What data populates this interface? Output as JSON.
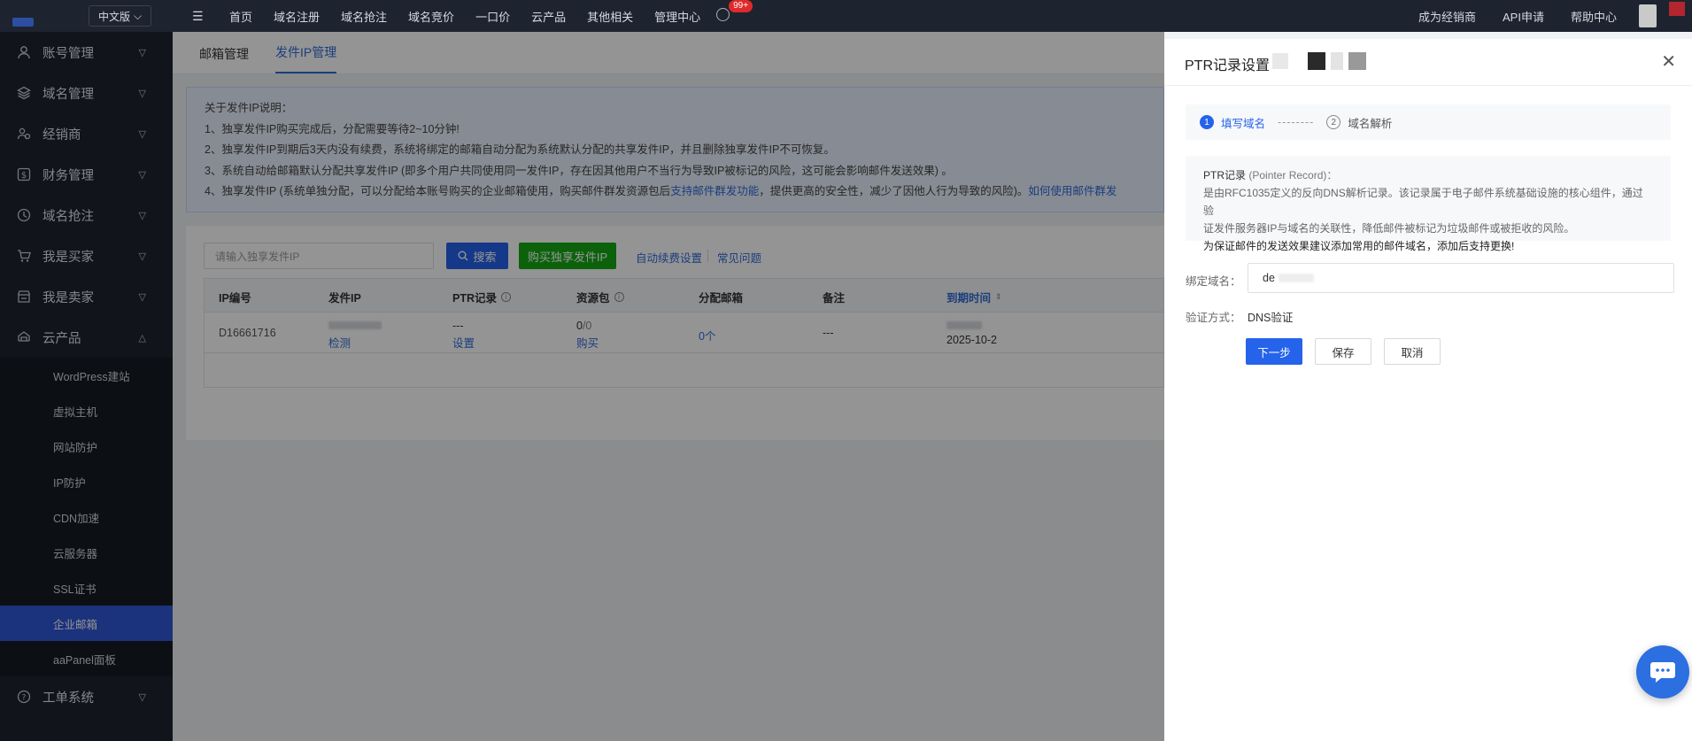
{
  "topbar": {
    "language": "中文版",
    "nav": [
      "首页",
      "域名注册",
      "域名抢注",
      "域名竞价",
      "一口价",
      "云产品",
      "其他相关",
      "管理中心"
    ],
    "badge": "99+",
    "right": [
      "成为经销商",
      "API申请",
      "帮助中心"
    ]
  },
  "sidebar": {
    "items": [
      {
        "label": "账号管理",
        "icon": "user-icon"
      },
      {
        "label": "域名管理",
        "icon": "layers-icon"
      },
      {
        "label": "经销商",
        "icon": "group-icon"
      },
      {
        "label": "财务管理",
        "icon": "dollar-icon"
      },
      {
        "label": "域名抢注",
        "icon": "clock-icon"
      },
      {
        "label": "我是买家",
        "icon": "cart-icon"
      },
      {
        "label": "我是卖家",
        "icon": "shop-icon"
      },
      {
        "label": "云产品",
        "icon": "cloud-icon"
      }
    ],
    "sub_items": [
      "WordPress建站",
      "虚拟主机",
      "网站防护",
      "IP防护",
      "CDN加速",
      "云服务器",
      "SSL证书",
      "企业邮箱",
      "aaPanel面板"
    ],
    "active_sub": "企业邮箱",
    "bottom_item": {
      "label": "工单系统",
      "icon": "help-icon"
    }
  },
  "main": {
    "tabs": [
      "邮箱管理",
      "发件IP管理"
    ],
    "active_tab": "发件IP管理",
    "notice": {
      "title": "关于发件IP说明：",
      "line1": "1、独享发件IP购买完成后，分配需要等待2~10分钟!",
      "line2": "2、独享发件IP到期后3天内没有续费，系统将绑定的邮箱自动分配为系统默认分配的共享发件IP，并且删除独享发件IP不可恢复。",
      "line3": "3、系统自动给邮箱默认分配共享发件IP (即多个用户共同使用同一发件IP，存在因其他用户不当行为导致IP被标记的风险，这可能会影响邮件发送效果) 。",
      "line4_a": "4、独享发件IP (系统单独分配，可以分配给本账号购买的企业邮箱使用，购买邮件群发资源包后",
      "line4_link1": "支持邮件群发功能",
      "line4_b": "，提供更高的安全性，减少了因他人行为导致的风险)。",
      "line4_link2": "如何使用邮件群发"
    },
    "search_placeholder": "请输入独享发件IP",
    "search_button": "搜索",
    "buy_button": "购买独享发件IP",
    "auto_renew_link": "自动续费设置",
    "faq_link": "常见问题",
    "table": {
      "headers": [
        "IP编号",
        "发件IP",
        "PTR记录",
        "资源包",
        "分配邮箱",
        "备注",
        "到期时间"
      ],
      "row": {
        "id": "D16661716",
        "ip_action": "检测",
        "ptr_value": "---",
        "ptr_action": "设置",
        "package_used": "0",
        "package_total": "/0",
        "package_action": "购买",
        "mailbox": "0个",
        "note": "---",
        "expire": "2025-10-2"
      }
    }
  },
  "drawer": {
    "title": "PTR记录设置",
    "steps": [
      {
        "num": "1",
        "label": "填写域名"
      },
      {
        "num": "2",
        "label": "域名解析"
      }
    ],
    "step_dash": "--------",
    "ptr_head": "PTR记录",
    "ptr_head_en": "(Pointer Record)：",
    "ptr_desc1": "是由RFC1035定义的反向DNS解析记录。该记录属于电子邮件系统基础设施的核心组件，通过验",
    "ptr_desc2": "证发件服务器IP与域名的关联性，降低邮件被标记为垃圾邮件或被拒收的风险。",
    "ptr_warn": "为保证邮件的发送效果建议添加常用的邮件域名，添加后支持更换!",
    "domain_label": "绑定域名：",
    "domain_value": "de",
    "verify_label": "验证方式：",
    "verify_value": "DNS验证",
    "next_button": "下一步",
    "save_button": "保存",
    "cancel_button": "取消"
  }
}
